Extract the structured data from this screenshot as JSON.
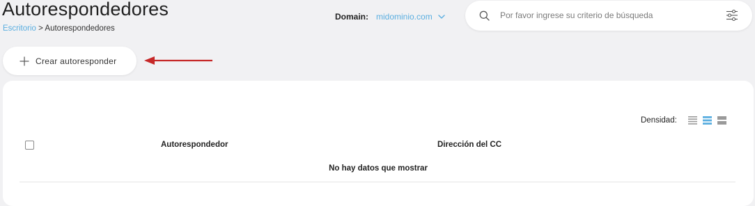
{
  "page": {
    "title": "Autorespondedores"
  },
  "breadcrumb": {
    "home": "Escritorio",
    "separator": ">",
    "current": "Autorespondedores"
  },
  "domain": {
    "label": "Domain:",
    "selected": "midominio.com"
  },
  "search": {
    "placeholder": "Por favor ingrese su criterio de búsqueda",
    "value": ""
  },
  "actions": {
    "create_label": "Crear autoresponder"
  },
  "annotation": {
    "arrow_color": "#c62828"
  },
  "table": {
    "density_label": "Densidad:",
    "density_options": [
      "compact",
      "standard",
      "comfortable"
    ],
    "density_selected": "standard",
    "columns": [
      "Autorespondedor",
      "Dirección del CC"
    ],
    "empty_message": "No hay datos que mostrar",
    "rows": []
  },
  "colors": {
    "accent": "#5aaee0",
    "background": "#f1f1f3",
    "card": "#ffffff",
    "text": "#222222"
  }
}
